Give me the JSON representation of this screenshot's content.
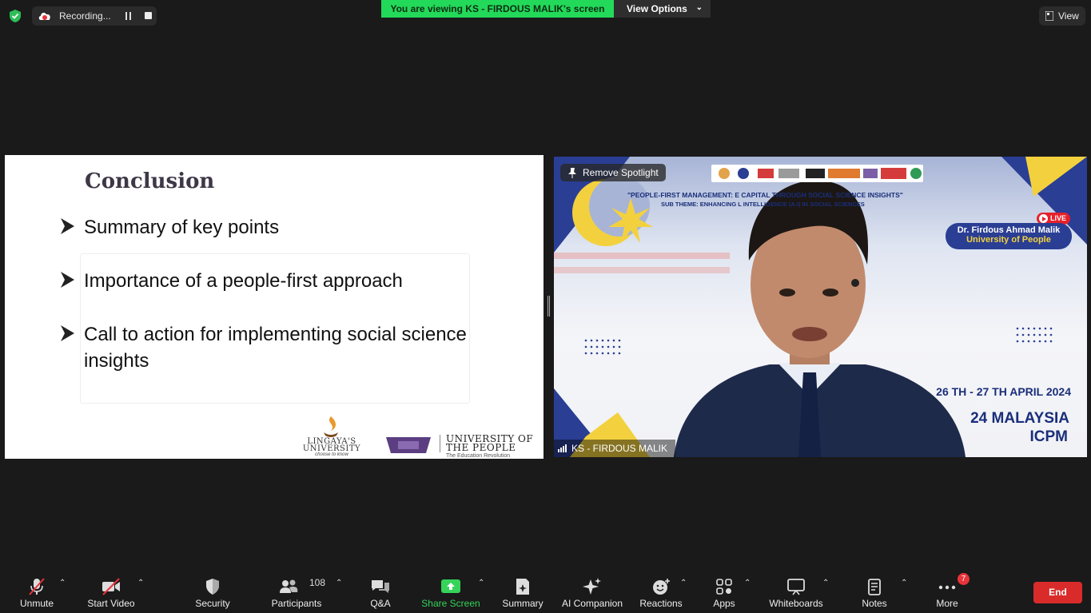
{
  "top": {
    "recording_label": "Recording...",
    "viewing_banner": "You are viewing KS - FIRDOUS MALIK's screen",
    "view_options_label": "View Options",
    "view_label": "View"
  },
  "slide": {
    "title": "Conclusion",
    "bullets": [
      "Summary of key points",
      " Importance of a people-first approach",
      "Call to action for implementing social science insights"
    ],
    "logo1_name": "LINGAYA'S UNIVERSITY",
    "logo1_tag": "choose to know",
    "logo2_name": "UNIVERSITY OF THE PEOPLE",
    "logo2_tag": "The Education Revolution"
  },
  "video": {
    "remove_spotlight": "Remove Spotlight",
    "banner_line1": "\"PEOPLE-FIRST MANAGEMENT: E               CAPITAL THROUGH SOCIAL SCIENCE INSIGHTS\"",
    "banner_line2": "SUB THEME:  ENHANCING                    L INTELLIGENCE (A.I) IN SOCIAL SCIENCES",
    "live_label": "LIVE",
    "speaker_name": "Dr. Firdous Ahmad Malik",
    "speaker_org": "University of People",
    "date": "26 TH - 27 TH APRIL 2024",
    "conf_line1": "24 MALAYSIA",
    "conf_line2": "ICPM",
    "participant_name": "KS - FIRDOUS MALIK"
  },
  "toolbar": {
    "unmute": "Unmute",
    "start_video": "Start Video",
    "security": "Security",
    "participants": "Participants",
    "participants_count": "108",
    "qa": "Q&A",
    "share_screen": "Share Screen",
    "summary": "Summary",
    "ai_companion": "AI Companion",
    "reactions": "Reactions",
    "apps": "Apps",
    "whiteboards": "Whiteboards",
    "notes": "Notes",
    "more": "More",
    "more_badge": "7",
    "end": "End"
  },
  "colors": {
    "share_green": "#35d35a",
    "banner_green": "#23d959",
    "end_red": "#da2b2b",
    "badge_red": "#e8333a"
  }
}
